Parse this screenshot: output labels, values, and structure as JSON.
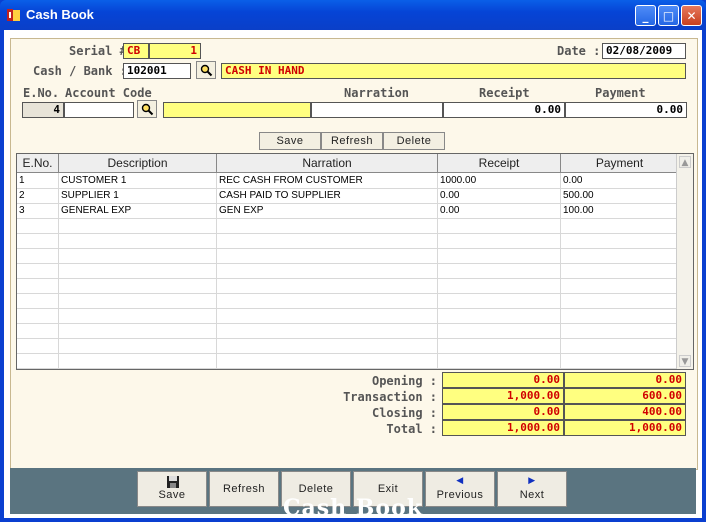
{
  "window": {
    "title": "Cash Book"
  },
  "header": {
    "serial_label": "Serial #",
    "serial_prefix": "CB",
    "serial_number": "1",
    "date_label": "Date :",
    "date_value": "02/08/2009",
    "cashbank_label": "Cash / Bank :",
    "cashbank_code": "102001",
    "cashbank_name": "CASH IN HAND"
  },
  "entry": {
    "eno_label": "E.No.",
    "account_label": "Account Code",
    "narration_label": "Narration",
    "receipt_label": "Receipt",
    "payment_label": "Payment",
    "eno_value": "4",
    "account_value": "",
    "account_name": "",
    "narration_value": "",
    "receipt_value": "0.00",
    "payment_value": "0.00"
  },
  "entry_buttons": {
    "save": "Save",
    "refresh": "Refresh",
    "delete": "Delete"
  },
  "grid": {
    "columns": [
      "E.No.",
      "Description",
      "Narration",
      "Receipt",
      "Payment"
    ],
    "rows": [
      {
        "eno": "1",
        "description": "CUSTOMER 1",
        "narration": "REC CASH FROM CUSTOMER",
        "receipt": "1000.00",
        "payment": "0.00"
      },
      {
        "eno": "2",
        "description": "SUPPLIER 1",
        "narration": "CASH PAID TO SUPPLIER",
        "receipt": "0.00",
        "payment": "500.00"
      },
      {
        "eno": "3",
        "description": "GENERAL EXP",
        "narration": "GEN EXP",
        "receipt": "0.00",
        "payment": "100.00"
      }
    ]
  },
  "totals": {
    "opening_label": "Opening :",
    "transaction_label": "Transaction :",
    "closing_label": "Closing :",
    "total_label": "Total :",
    "opening_receipt": "0.00",
    "opening_payment": "0.00",
    "transaction_receipt": "1,000.00",
    "transaction_payment": "600.00",
    "closing_receipt": "0.00",
    "closing_payment": "400.00",
    "total_receipt": "1,000.00",
    "total_payment": "1,000.00"
  },
  "toolbar": {
    "save": "Save",
    "refresh": "Refresh",
    "delete": "Delete",
    "exit": "Exit",
    "previous": "Previous",
    "next": "Next"
  },
  "brand": "Cash Book",
  "colors": {
    "field_yellow": "#ffff80",
    "value_red": "#d00000",
    "panel": "#5a7480"
  }
}
